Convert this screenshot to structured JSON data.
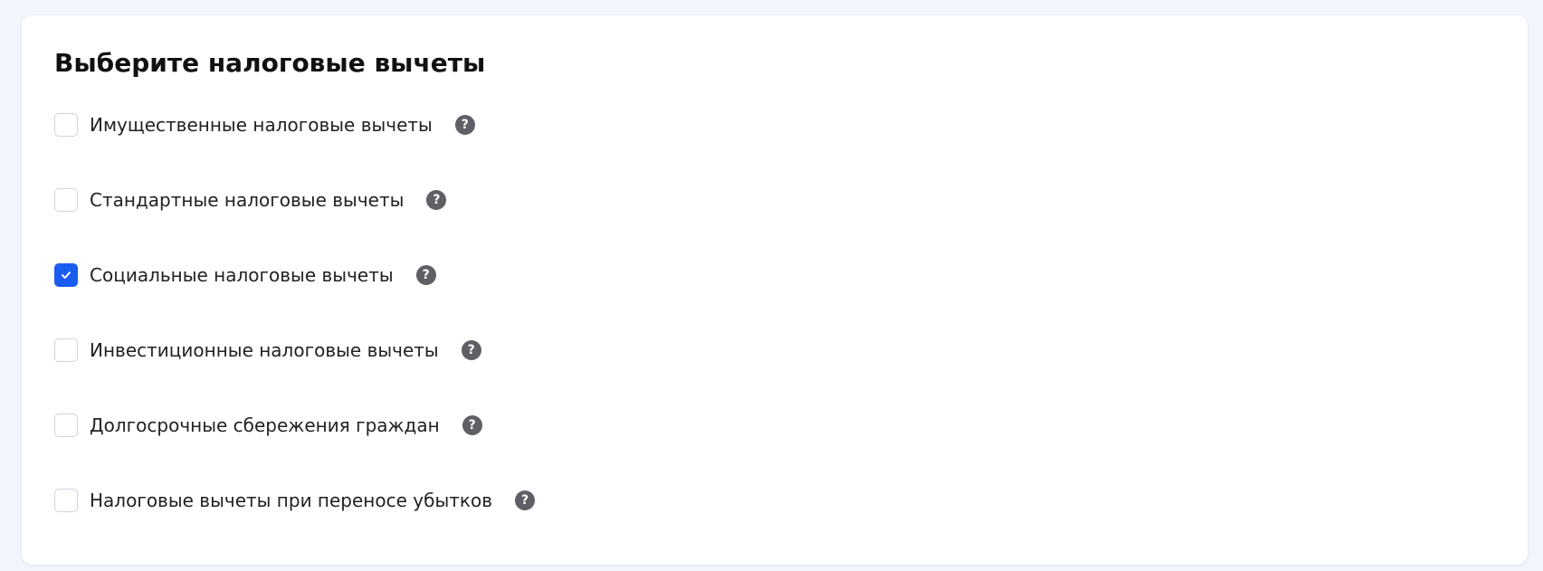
{
  "page": {
    "title": "Выберите налоговые вычеты"
  },
  "options": [
    {
      "label": "Имущественные налоговые вычеты",
      "checked": false,
      "help_glyph": "?"
    },
    {
      "label": "Стандартные налоговые вычеты",
      "checked": false,
      "help_glyph": "?"
    },
    {
      "label": "Социальные налоговые вычеты",
      "checked": true,
      "help_glyph": "?"
    },
    {
      "label": "Инвестиционные налоговые вычеты",
      "checked": false,
      "help_glyph": "?"
    },
    {
      "label": "Долгосрочные сбережения граждан",
      "checked": false,
      "help_glyph": "?"
    },
    {
      "label": "Налоговые вычеты при переносе убытков",
      "checked": false,
      "help_glyph": "?"
    }
  ],
  "icons": {
    "check": "check-icon",
    "help": "question-circle-icon"
  },
  "colors": {
    "accent": "#1a5cf0",
    "background": "#f2f5fc",
    "card": "#ffffff",
    "help_icon": "#5e6066",
    "text": "#222222"
  }
}
